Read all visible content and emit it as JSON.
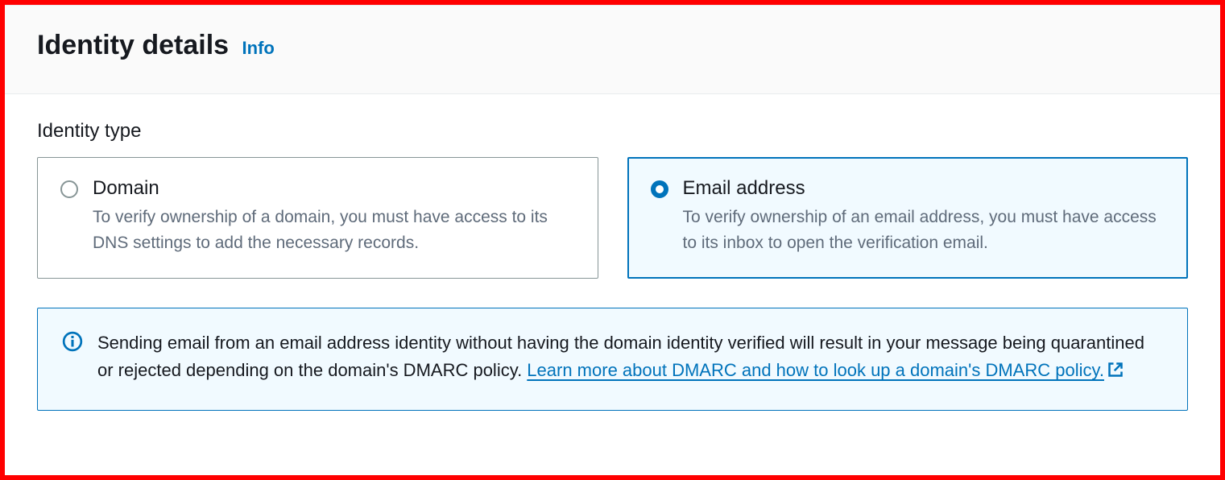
{
  "header": {
    "title": "Identity details",
    "info_link": "Info"
  },
  "identity_type": {
    "label": "Identity type",
    "options": [
      {
        "title": "Domain",
        "description": "To verify ownership of a domain, you must have access to its DNS settings to add the necessary records.",
        "selected": false
      },
      {
        "title": "Email address",
        "description": "To verify ownership of an email address, you must have access to its inbox to open the verification email.",
        "selected": true
      }
    ]
  },
  "info_box": {
    "text": "Sending email from an email address identity without having the domain identity verified will result in your message being quarantined or rejected depending on the domain's DMARC policy. ",
    "link_text": "Learn more about DMARC and how to look up a domain's DMARC policy."
  }
}
